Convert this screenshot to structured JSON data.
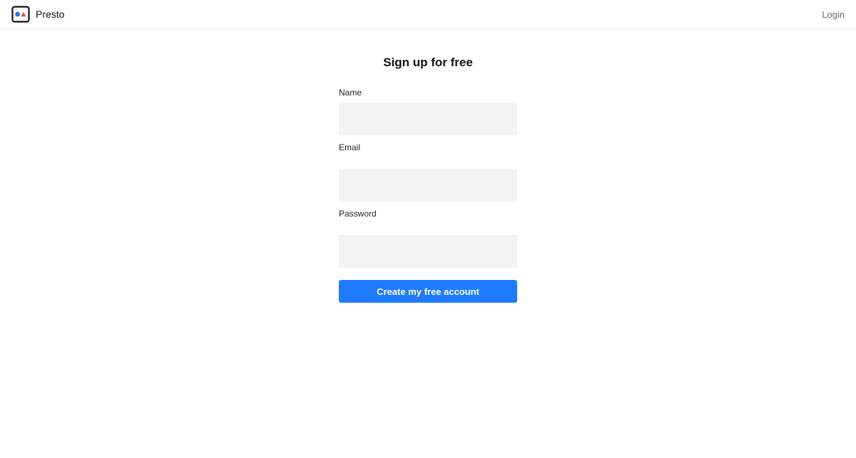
{
  "app": {
    "brand_name": "Presto",
    "logo_icon": "presto-logo-icon",
    "logo_colors": {
      "frame": "#111111",
      "circle": "#2f6fe4",
      "triangle": "#e8503a"
    }
  },
  "header": {
    "login_label": "Login"
  },
  "signup": {
    "title": "Sign up for free",
    "fields": [
      {
        "label": "Name",
        "value": "",
        "placeholder": ""
      },
      {
        "label": "Email",
        "value": "",
        "placeholder": ""
      },
      {
        "label": "Password",
        "value": "",
        "placeholder": ""
      }
    ],
    "submit_label": "Create my free account"
  },
  "colors": {
    "accent": "#1f7bff",
    "input_background": "#f3f3f3",
    "header_border": "#e2e2e2",
    "muted_text": "#6b6b6b"
  }
}
